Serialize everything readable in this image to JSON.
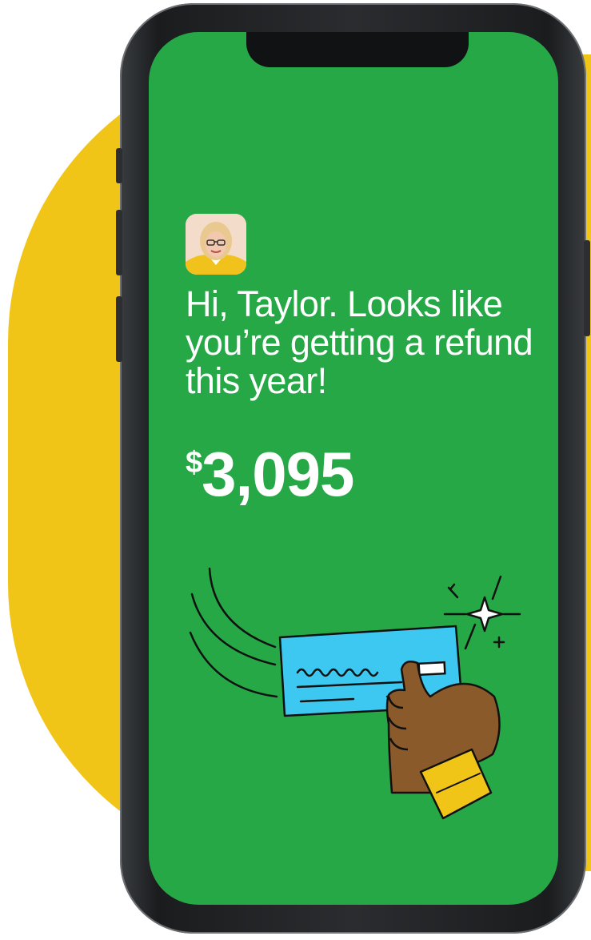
{
  "message": {
    "greeting": "Hi, Taylor. Looks like you’re getting a refund this year!",
    "currency_symbol": "$",
    "refund_amount": "3,095"
  },
  "icons": {
    "avatar": "advisor-avatar",
    "check": "check-icon",
    "hand": "hand-icon",
    "sparkle": "sparkle-icon"
  },
  "colors": {
    "screen_background": "#26a846",
    "blob": "#f0c517",
    "check": "#3cc8f0",
    "skin": "#8b5a2b",
    "cuff": "#f0c517"
  }
}
